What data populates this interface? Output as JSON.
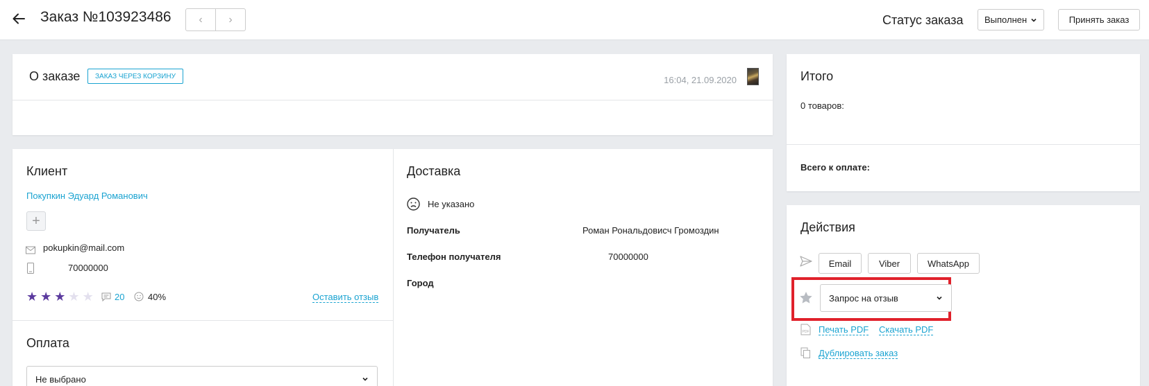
{
  "header": {
    "order_title": "Заказ №103923486",
    "status_label": "Статус заказа",
    "status_value": "Выполнен",
    "accept_label": "Принять заказ"
  },
  "about": {
    "title": "О заказе",
    "badge": "ЗАКАЗ ЧЕРЕЗ КОРЗИНУ",
    "datetime": "16:04, 21.09.2020"
  },
  "client": {
    "title": "Клиент",
    "name": "Покупкин Эдуард Романович",
    "email": "pokupkin@mail.com",
    "phone": "70000000",
    "rating": 3,
    "rating_max": 5,
    "comments_count": "20",
    "satisfaction": "40%",
    "review_link": "Оставить отзыв"
  },
  "payment": {
    "title": "Оплата",
    "selected": "Не выбрано"
  },
  "delivery": {
    "title": "Доставка",
    "status": "Не указано",
    "recipient_label": "Получатель",
    "recipient_value": "Роман Рональдовисч Громоздин",
    "phone_label": "Телефон получателя",
    "phone_value": "70000000",
    "city_label": "Город"
  },
  "totals": {
    "title": "Итого",
    "items": "0 товаров:",
    "total_label": "Всего к оплате:"
  },
  "actions": {
    "title": "Действия",
    "email": "Email",
    "viber": "Viber",
    "whatsapp": "WhatsApp",
    "review_request": "Запрос на отзыв",
    "print_pdf": "Печать PDF",
    "download_pdf": "Скачать PDF",
    "duplicate": "Дублировать заказ"
  },
  "colors": {
    "accent": "#1aa3d1",
    "star_filled": "#5b3a9e",
    "star_empty": "#e3e0ee",
    "highlight": "#e0212b"
  }
}
